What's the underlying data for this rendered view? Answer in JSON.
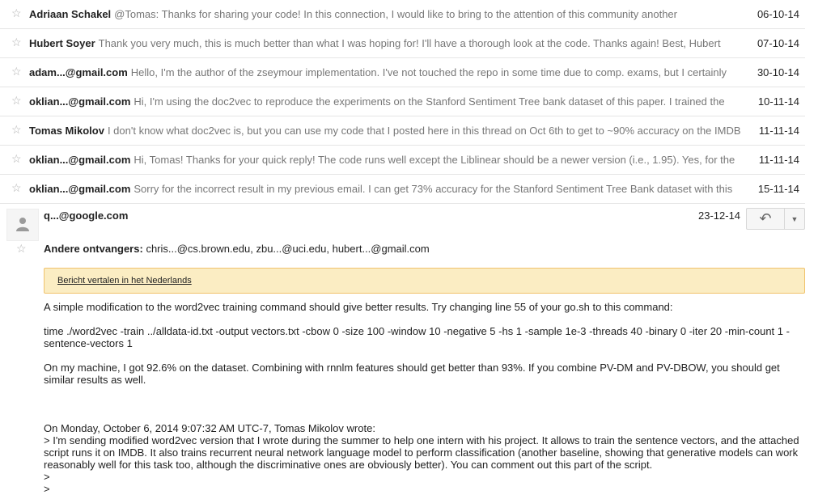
{
  "thread": [
    {
      "sender": "Adriaan Schakel",
      "snippet": "@Tomas: Thanks for sharing your code! In this connection, I would like to bring to the attention of this community another",
      "date": "06-10-14"
    },
    {
      "sender": "Hubert Soyer",
      "snippet": "Thank you very much, this is much better than what I was hoping for! I'll have a thorough look at the code. Thanks again! Best, Hubert",
      "date": "07-10-14"
    },
    {
      "sender": "adam...@gmail.com",
      "snippet": "Hello, I'm the author of the zseymour implementation. I've not touched the repo in some time due to comp. exams, but I certainly",
      "date": "30-10-14"
    },
    {
      "sender": "oklian...@gmail.com",
      "snippet": "Hi, I'm using the doc2vec to reproduce the experiments on the Stanford Sentiment Tree bank dataset of this paper. I trained the",
      "date": "10-11-14"
    },
    {
      "sender": "Tomas Mikolov",
      "snippet": "I don't know what doc2vec is, but you can use my code that I posted here in this thread on Oct 6th to get to ~90% accuracy on the IMDB",
      "date": "11-11-14"
    },
    {
      "sender": "oklian...@gmail.com",
      "snippet": "Hi, Tomas! Thanks for your quick reply! The code runs well except the Liblinear should be a newer version (i.e., 1.95). Yes, for the",
      "date": "11-11-14"
    },
    {
      "sender": "oklian...@gmail.com",
      "snippet": "Sorry for the incorrect result in my previous email. I can get 73% accuracy for the Stanford Sentiment Tree Bank dataset with this",
      "date": "15-11-14"
    }
  ],
  "message": {
    "from": "q...@google.com",
    "date": "23-12-14",
    "recipients_label": "Andere ontvangers:",
    "recipients": "chris...@cs.brown.edu, zbu...@uci.edu, hubert...@gmail.com",
    "translate_link": "Bericht vertalen in het Nederlands",
    "p1": "A simple modification to the word2vec training command should give better results. Try changing line 55 of your go.sh to this command:",
    "p2": "time ./word2vec -train ../alldata-id.txt -output vectors.txt -cbow 0 -size 100 -window 10 -negative 5 -hs 1 -sample 1e-3 -threads 40 -binary 0 -iter 20 -min-count 1 -sentence-vectors 1",
    "p3": "On my machine, I got 92.6% on the dataset. Combining with rnnlm features should get better than 93%. If you combine PV-DM and PV-DBOW, you should get similar results as well.",
    "quote_header": "On Monday, October 6, 2014 9:07:32 AM UTC-7, Tomas Mikolov wrote:",
    "quote_body": "> I'm sending modified word2vec version that I wrote during the summer to help one intern with his project. It allows to train the sentence vectors, and the attached script runs it on IMDB. It also trains recurrent neural network language model to perform classification (another baseline, showing that generative models can work reasonably well for this task too, although the discriminative ones are obviously better). You can comment out this part of the script.",
    "quote_gt1": ">",
    "quote_gt2": ">"
  },
  "icons": {
    "star": "star-icon",
    "avatar": "person-icon",
    "reply": "reply-all-icon",
    "more": "chevron-down-icon"
  }
}
